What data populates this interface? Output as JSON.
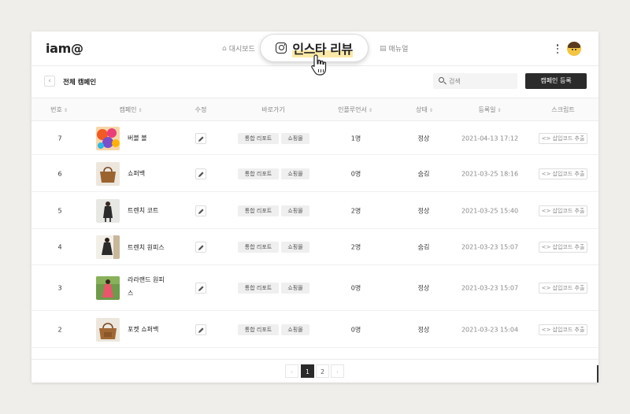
{
  "app": {
    "logo": "iam@"
  },
  "nav": {
    "dashboard": "대시보드",
    "manual": "매뉴얼"
  },
  "feature_pill": {
    "label": "인스타 리뷰"
  },
  "toolbar": {
    "back_glyph": "‹",
    "title": "전체 캠페인",
    "search_placeholder": "검색",
    "register_label": "캠페인 등록"
  },
  "table": {
    "headers": {
      "no": "번호",
      "campaign": "캠페인",
      "edit": "수정",
      "shortcut": "바로가기",
      "influencer": "인플루언서",
      "status": "상태",
      "date": "등록일",
      "script": "스크립트"
    },
    "sort_glyph": "⇕",
    "report_label": "통합 리포트",
    "shop_label": "쇼핑몰",
    "code_label": "<> 삽입코드 추출",
    "rows": [
      {
        "no": "7",
        "name": "버블 볼",
        "influencers": "1명",
        "status": "정상",
        "date": "2021-04-13 17:12"
      },
      {
        "no": "6",
        "name": "쇼퍼백",
        "influencers": "0명",
        "status": "숨김",
        "date": "2021-03-25 18:16"
      },
      {
        "no": "5",
        "name": "트렌치 코트",
        "influencers": "2명",
        "status": "정상",
        "date": "2021-03-25 15:40"
      },
      {
        "no": "4",
        "name": "트렌치 원피스",
        "influencers": "2명",
        "status": "숨김",
        "date": "2021-03-23 15:07"
      },
      {
        "no": "3",
        "name": "라라랜드 원피스",
        "influencers": "0명",
        "status": "정상",
        "date": "2021-03-23 15:07"
      },
      {
        "no": "2",
        "name": "포켓 쇼퍼백",
        "influencers": "0명",
        "status": "정상",
        "date": "2021-03-23 15:04"
      }
    ]
  },
  "pagination": {
    "prev": "‹",
    "pages": [
      "1",
      "2"
    ],
    "next": "›",
    "current": "1"
  },
  "colors": {
    "accent_dark": "#2b2b2b",
    "highlight": "#fbe9a8",
    "background": "#efeeeb"
  },
  "icons": {
    "dashboard": "home-icon",
    "manual": "document-icon",
    "pill": "instagram-icon",
    "search": "search-icon",
    "edit": "pencil-icon"
  }
}
